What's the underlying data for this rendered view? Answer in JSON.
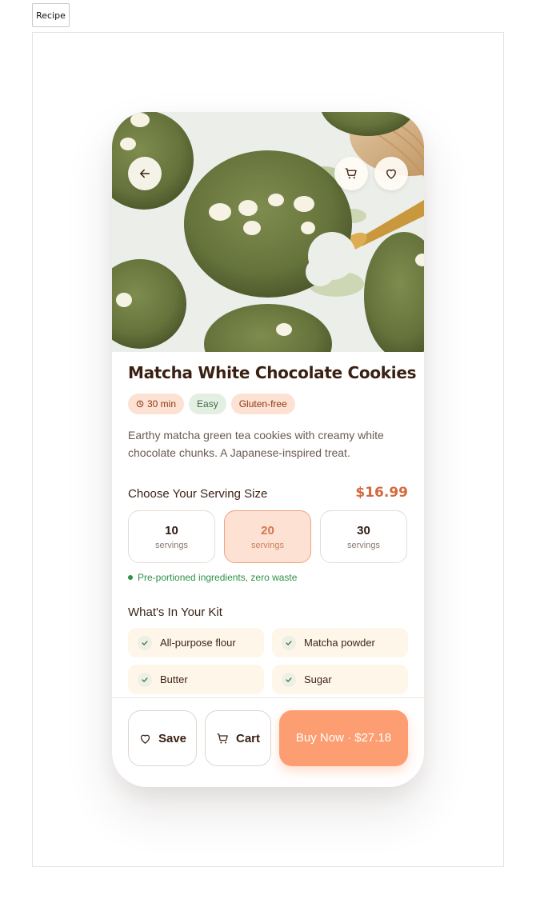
{
  "tab": {
    "label": "Recipe"
  },
  "hero": {
    "image_alt": "Matcha white chocolate cookies",
    "back_icon": "arrow-left-icon",
    "cart_icon": "cart-icon",
    "favorite_icon": "heart-icon"
  },
  "recipe": {
    "title": "Matcha White Chocolate Cookies",
    "tags": {
      "time": "30 min",
      "difficulty": "Easy",
      "diet": "Gluten-free"
    },
    "description": "Earthy matcha green tea cookies with creamy white chocolate chunks. A Japanese-inspired treat."
  },
  "serving": {
    "label": "Choose Your Serving Size",
    "price": "$16.99",
    "options": [
      {
        "count": "10",
        "unit": "servings",
        "selected": false
      },
      {
        "count": "20",
        "unit": "servings",
        "selected": true
      },
      {
        "count": "30",
        "unit": "servings",
        "selected": false
      }
    ],
    "note": "Pre-portioned ingredients, zero waste"
  },
  "kit": {
    "title": "What's In Your Kit",
    "items": [
      "All-purpose flour",
      "Matcha powder",
      "Butter",
      "Sugar"
    ]
  },
  "actions": {
    "save_label": "Save",
    "cart_label": "Cart",
    "buy_label": "Buy Now · $27.18"
  },
  "colors": {
    "accent": "#fd9d72",
    "price": "#d36a3f",
    "selected_bg": "#fde1d3",
    "note_green": "#2e9147",
    "kit_item_bg": "#fff6ea"
  }
}
